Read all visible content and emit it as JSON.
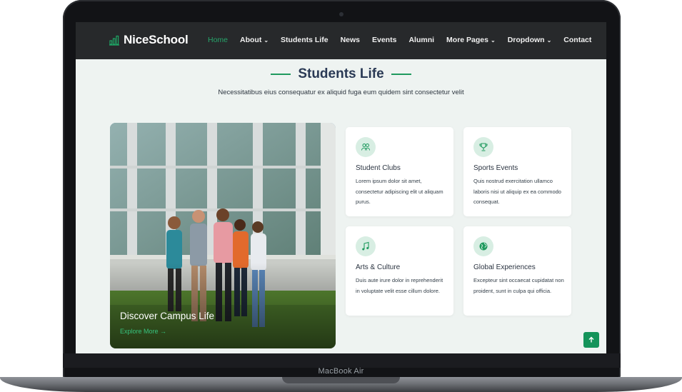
{
  "device": {
    "label": "MacBook Air"
  },
  "header": {
    "brand": "NiceSchool",
    "nav": [
      {
        "label": "Home",
        "active": true
      },
      {
        "label": "About",
        "dropdown": true
      },
      {
        "label": "Students Life"
      },
      {
        "label": "News"
      },
      {
        "label": "Events"
      },
      {
        "label": "Alumni"
      },
      {
        "label": "More Pages",
        "dropdown": true
      },
      {
        "label": "Dropdown",
        "dropdown": true
      },
      {
        "label": "Contact"
      }
    ]
  },
  "section": {
    "title": "Students Life",
    "subtitle": "Necessitatibus eius consequatur ex aliquid fuga eum quidem sint consectetur velit"
  },
  "campus": {
    "title": "Discover Campus Life",
    "link": "Explore More →"
  },
  "features": [
    {
      "icon": "people-icon",
      "title": "Student Clubs",
      "desc": "Lorem ipsum dolor sit amet, consectetur adipiscing elit ut aliquam purus."
    },
    {
      "icon": "trophy-icon",
      "title": "Sports Events",
      "desc": "Quis nostrud exercitation ullamco laboris nisi ut aliquip ex ea commodo consequat."
    },
    {
      "icon": "music-icon",
      "title": "Arts & Culture",
      "desc": "Duis aute irure dolor in reprehenderit in voluptate velit esse cillum dolore."
    },
    {
      "icon": "globe-icon",
      "title": "Global Experiences",
      "desc": "Excepteur sint occaecat cupidatat non proident, sunt in culpa qui officia."
    }
  ],
  "colors": {
    "accent": "#1f9a5e",
    "header_bg": "#27292b",
    "title": "#2a3a55",
    "section_bg": "#eef3f1"
  },
  "scroll_top": {
    "icon": "arrow-up-icon"
  }
}
